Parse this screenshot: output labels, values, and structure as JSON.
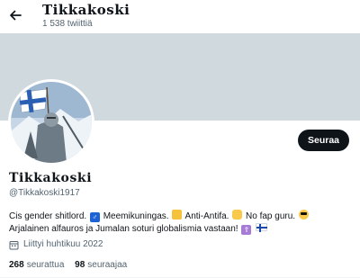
{
  "header": {
    "title": "Tikkakoski",
    "tweet_count": "1 538 twiittiä",
    "back_icon": "arrow-left-icon"
  },
  "profile": {
    "display_name": "Tikkakoski",
    "handle": "@Tikkakoski1917",
    "follow_label": "Seuraa",
    "bio": {
      "line1_a": "Cis gender shitlord.",
      "line1_b": "Meemikuningas.",
      "line1_c": "Anti-Antifa.",
      "line1_d": "No fap guru.",
      "line2": "Arjalainen alfauros ja Jumalan soturi globalismia vastaan!"
    },
    "joined": "Liittyi huhtikuu 2022",
    "following_count": "268",
    "following_label": "seurattua",
    "followers_count": "98",
    "followers_label": "seuraajaa"
  },
  "colors": {
    "banner": "#cfd9de",
    "button_bg": "#0f1419",
    "secondary_text": "#536471"
  }
}
